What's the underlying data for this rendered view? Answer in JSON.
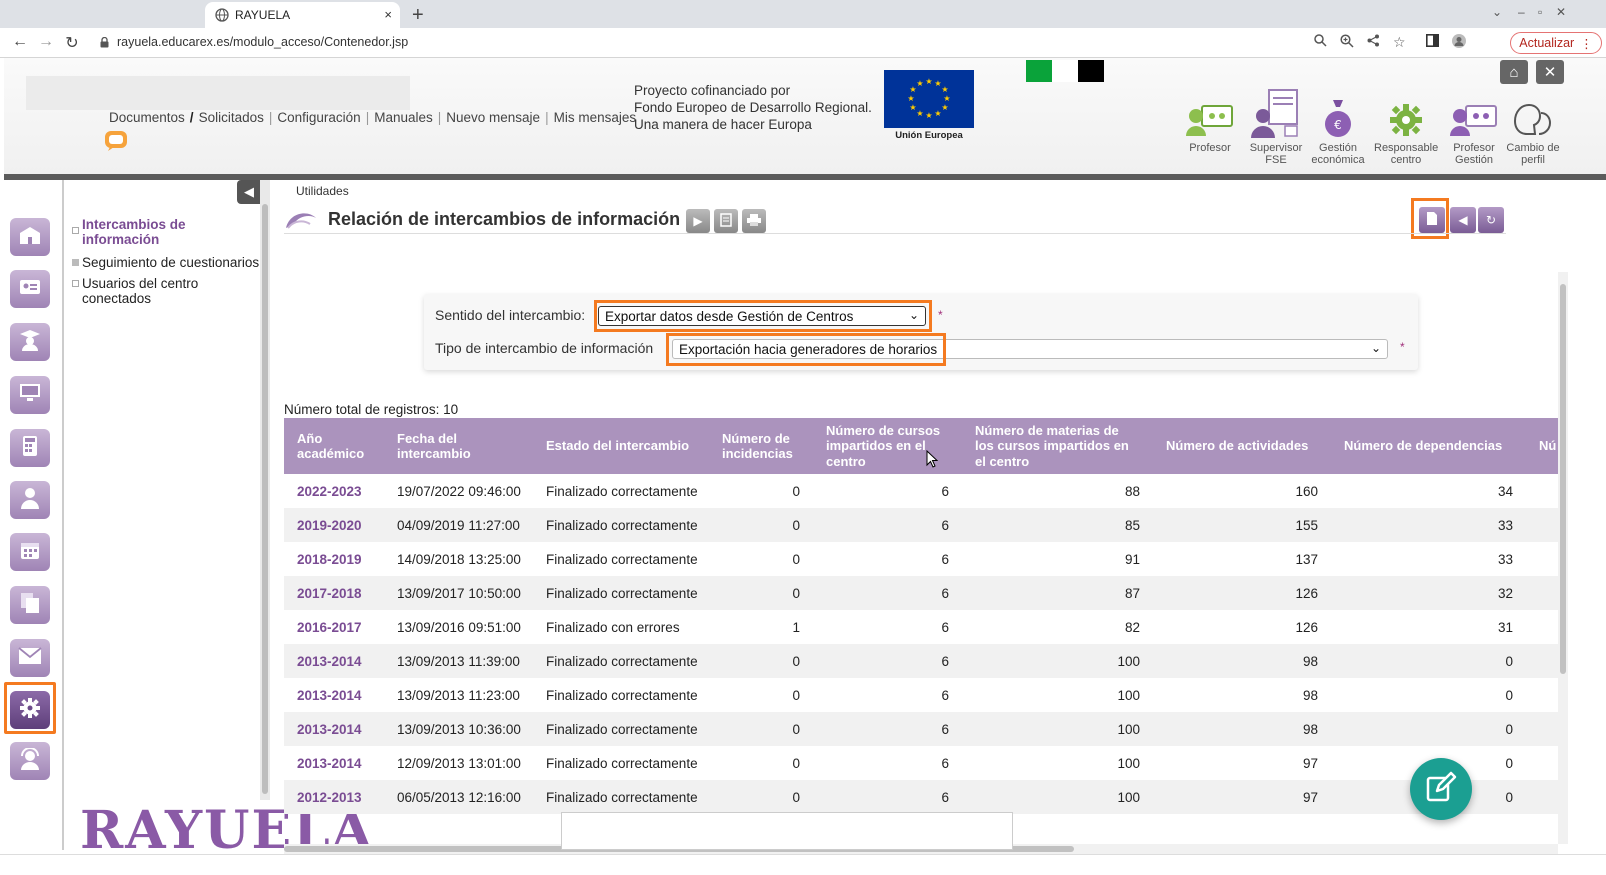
{
  "browser": {
    "tab_title": "RAYUELA",
    "tab_close": "×",
    "new_tab": "+",
    "url": "rayuela.educarex.es/modulo_acceso/Contenedor.jsp",
    "update_label": "Actualizar"
  },
  "header": {
    "menu": [
      "Documentos",
      "Solicitados",
      "Configuración",
      "Manuales",
      "Nuevo mensaje",
      "Mis mensajes"
    ],
    "cofinanced": [
      "Proyecto cofinanciado por",
      "Fondo Europeo de Desarrollo Regional.",
      "Una manera de hacer Europa"
    ],
    "eu_label": "Unión Europea",
    "roles": [
      {
        "label": "Profesor",
        "icon": "teacher-icon"
      },
      {
        "label": "Supervisor FSE",
        "icon": "supervisor-icon"
      },
      {
        "label": "Gestión económica",
        "icon": "money-bag-icon"
      },
      {
        "label": "Responsable centro",
        "icon": "gear-icon"
      },
      {
        "label": "Profesor Gestión",
        "icon": "teacher-management-icon"
      },
      {
        "label": "Cambio de perfil",
        "icon": "profile-change-icon"
      }
    ],
    "colors": {
      "accent": "#7a4c93",
      "highlight": "#f47a20"
    }
  },
  "sidebar": {
    "items": [
      {
        "label": "Intercambios de información",
        "active": true
      },
      {
        "label": "Seguimiento de cuestionarios",
        "active": false
      },
      {
        "label": "Usuarios del centro conectados",
        "active": false
      }
    ],
    "logo_text": "RAYUELA",
    "rail_icons": [
      "school-icon",
      "id-card-icon",
      "graduate-icon",
      "monitor-icon",
      "calculator-icon",
      "person-icon",
      "calendar-icon",
      "documents-icon",
      "mail-icon",
      "settings-icon",
      "support-icon"
    ]
  },
  "main": {
    "breadcrumb": "Utilidades",
    "title": "Relación de intercambios de información",
    "filters": {
      "direction_label": "Sentido del intercambio:",
      "direction_value": "Exportar datos desde Gestión de Centros",
      "type_label": "Tipo de intercambio de información",
      "type_value": "Exportación hacia generadores de horarios",
      "required_mark": "*"
    },
    "total_label": "Número total de registros: 10",
    "columns": [
      "Año académico",
      "Fecha del intercambio",
      "Estado del intercambio",
      "Número de incidencias",
      "Número de cursos impartidos en el centro",
      "Número de materias de los cursos impartidos en el centro",
      "Número de actividades",
      "Número de dependencias",
      "Nú de"
    ],
    "rows": [
      [
        "2022-2023",
        "19/07/2022 09:46:00",
        "Finalizado correctamente",
        "0",
        "6",
        "88",
        "160",
        "34"
      ],
      [
        "2019-2020",
        "04/09/2019 11:27:00",
        "Finalizado correctamente",
        "0",
        "6",
        "85",
        "155",
        "33"
      ],
      [
        "2018-2019",
        "14/09/2018 13:25:00",
        "Finalizado correctamente",
        "0",
        "6",
        "91",
        "137",
        "33"
      ],
      [
        "2017-2018",
        "13/09/2017 10:50:00",
        "Finalizado correctamente",
        "0",
        "6",
        "87",
        "126",
        "32"
      ],
      [
        "2016-2017",
        "13/09/2016 09:51:00",
        "Finalizado con errores",
        "1",
        "6",
        "82",
        "126",
        "31"
      ],
      [
        "2013-2014",
        "13/09/2013 11:39:00",
        "Finalizado correctamente",
        "0",
        "6",
        "100",
        "98",
        "0"
      ],
      [
        "2013-2014",
        "13/09/2013 11:23:00",
        "Finalizado correctamente",
        "0",
        "6",
        "100",
        "98",
        "0"
      ],
      [
        "2013-2014",
        "13/09/2013 10:36:00",
        "Finalizado correctamente",
        "0",
        "6",
        "100",
        "98",
        "0"
      ],
      [
        "2013-2014",
        "12/09/2013 13:01:00",
        "Finalizado correctamente",
        "0",
        "6",
        "100",
        "97",
        "0"
      ],
      [
        "2012-2013",
        "06/05/2013 12:16:00",
        "Finalizado correctamente",
        "0",
        "6",
        "100",
        "97",
        "0"
      ]
    ]
  }
}
